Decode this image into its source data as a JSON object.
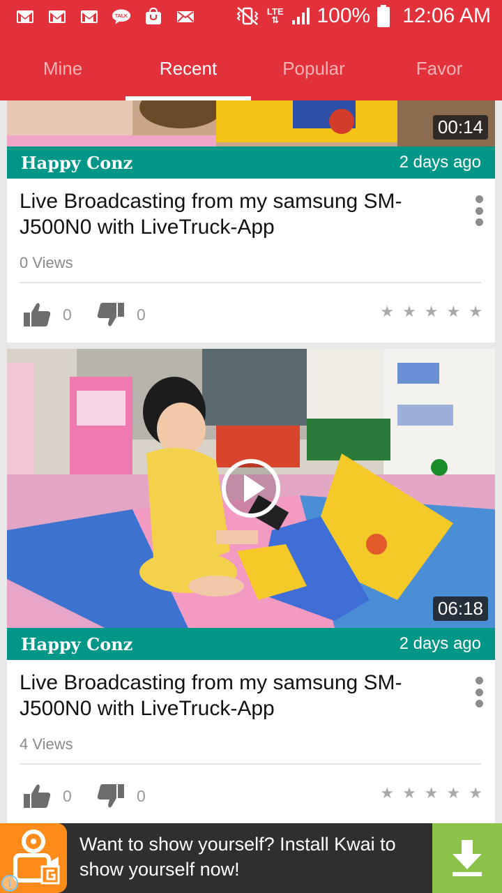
{
  "status_bar": {
    "notification_icons": [
      "gmail-icon",
      "gmail-icon",
      "gmail-icon",
      "kakaotalk-icon",
      "galaxy-apps-icon",
      "email-icon"
    ],
    "talk_label": "TALK",
    "network": "LTE",
    "battery": "100%",
    "time": "12:06 AM"
  },
  "tabs": [
    {
      "label": "Mine",
      "active": false
    },
    {
      "label": "Recent",
      "active": true
    },
    {
      "label": "Popular",
      "active": false
    },
    {
      "label": "Favor",
      "active": false
    }
  ],
  "videos": [
    {
      "duration": "00:14",
      "channel": "Happy Conz",
      "posted": "2 days ago",
      "title": "Live Broadcasting from my samsung SM-J500N0 with LiveTruck-App",
      "views": "0 Views",
      "likes": "0",
      "dislikes": "0",
      "rating": 0
    },
    {
      "duration": "06:18",
      "channel": "Happy Conz",
      "posted": "2 days ago",
      "title": "Live Broadcasting from my samsung SM-J500N0 with LiveTruck-App",
      "views": "4 Views",
      "likes": "0",
      "dislikes": "0",
      "rating": 0
    }
  ],
  "ad": {
    "text": "Want to show yourself? Install Kwai to show yourself now!",
    "icon": "download-icon"
  },
  "colors": {
    "header": "#e2313a",
    "channel_bar": "#009688",
    "ad_download": "#8bc34a",
    "ad_logo": "#ff8c1a"
  }
}
